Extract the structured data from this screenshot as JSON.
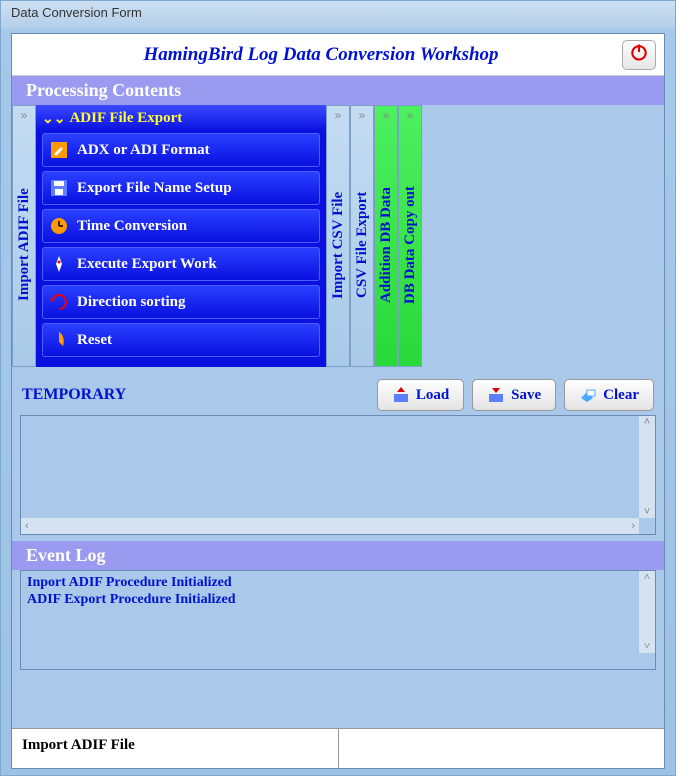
{
  "window_title": "Data Conversion Form",
  "app_title": "HamingBird Log Data Conversion Workshop",
  "sections": {
    "processing": "Processing Contents",
    "temporary": "TEMPORARY",
    "eventlog": "Event Log"
  },
  "side_tabs": [
    {
      "label": "Import ADIF File",
      "style": "blue"
    },
    {
      "label": "ADIF File Export",
      "style": "expanded"
    },
    {
      "label": "Import CSV File",
      "style": "blue"
    },
    {
      "label": "CSV File Export",
      "style": "blue"
    },
    {
      "label": "Addition DB Data",
      "style": "green"
    },
    {
      "label": "DB Data Copy out",
      "style": "green"
    }
  ],
  "expanded_panel": {
    "title": "ADIF File Export",
    "items": [
      {
        "icon": "edit-icon",
        "label": "ADX or ADI Format"
      },
      {
        "icon": "save-icon",
        "label": "Export File Name Setup"
      },
      {
        "icon": "clock-icon",
        "label": "Time Conversion"
      },
      {
        "icon": "rocket-icon",
        "label": "Execute  Export Work"
      },
      {
        "icon": "sort-icon",
        "label": "Direction sorting"
      },
      {
        "icon": "reset-icon",
        "label": "Reset"
      }
    ]
  },
  "buttons": {
    "load": "Load",
    "save": "Save",
    "clear": "Clear"
  },
  "event_log_lines": [
    "Inport ADIF Procedure Initialized",
    "ADIF Export Procedure Initialized"
  ],
  "status": {
    "left": "Import ADIF File",
    "right": ""
  }
}
